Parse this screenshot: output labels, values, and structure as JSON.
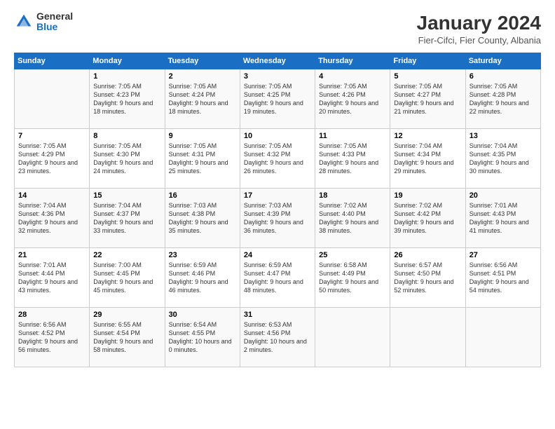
{
  "header": {
    "logo": {
      "general": "General",
      "blue": "Blue"
    },
    "title": "January 2024",
    "subtitle": "Fier-Cifci, Fier County, Albania"
  },
  "calendar": {
    "days": [
      "Sunday",
      "Monday",
      "Tuesday",
      "Wednesday",
      "Thursday",
      "Friday",
      "Saturday"
    ],
    "weeks": [
      [
        {
          "day": "",
          "sunrise": "",
          "sunset": "",
          "daylight": ""
        },
        {
          "day": "1",
          "sunrise": "Sunrise: 7:05 AM",
          "sunset": "Sunset: 4:23 PM",
          "daylight": "Daylight: 9 hours and 18 minutes."
        },
        {
          "day": "2",
          "sunrise": "Sunrise: 7:05 AM",
          "sunset": "Sunset: 4:24 PM",
          "daylight": "Daylight: 9 hours and 18 minutes."
        },
        {
          "day": "3",
          "sunrise": "Sunrise: 7:05 AM",
          "sunset": "Sunset: 4:25 PM",
          "daylight": "Daylight: 9 hours and 19 minutes."
        },
        {
          "day": "4",
          "sunrise": "Sunrise: 7:05 AM",
          "sunset": "Sunset: 4:26 PM",
          "daylight": "Daylight: 9 hours and 20 minutes."
        },
        {
          "day": "5",
          "sunrise": "Sunrise: 7:05 AM",
          "sunset": "Sunset: 4:27 PM",
          "daylight": "Daylight: 9 hours and 21 minutes."
        },
        {
          "day": "6",
          "sunrise": "Sunrise: 7:05 AM",
          "sunset": "Sunset: 4:28 PM",
          "daylight": "Daylight: 9 hours and 22 minutes."
        }
      ],
      [
        {
          "day": "7",
          "sunrise": "Sunrise: 7:05 AM",
          "sunset": "Sunset: 4:29 PM",
          "daylight": "Daylight: 9 hours and 23 minutes."
        },
        {
          "day": "8",
          "sunrise": "Sunrise: 7:05 AM",
          "sunset": "Sunset: 4:30 PM",
          "daylight": "Daylight: 9 hours and 24 minutes."
        },
        {
          "day": "9",
          "sunrise": "Sunrise: 7:05 AM",
          "sunset": "Sunset: 4:31 PM",
          "daylight": "Daylight: 9 hours and 25 minutes."
        },
        {
          "day": "10",
          "sunrise": "Sunrise: 7:05 AM",
          "sunset": "Sunset: 4:32 PM",
          "daylight": "Daylight: 9 hours and 26 minutes."
        },
        {
          "day": "11",
          "sunrise": "Sunrise: 7:05 AM",
          "sunset": "Sunset: 4:33 PM",
          "daylight": "Daylight: 9 hours and 28 minutes."
        },
        {
          "day": "12",
          "sunrise": "Sunrise: 7:04 AM",
          "sunset": "Sunset: 4:34 PM",
          "daylight": "Daylight: 9 hours and 29 minutes."
        },
        {
          "day": "13",
          "sunrise": "Sunrise: 7:04 AM",
          "sunset": "Sunset: 4:35 PM",
          "daylight": "Daylight: 9 hours and 30 minutes."
        }
      ],
      [
        {
          "day": "14",
          "sunrise": "Sunrise: 7:04 AM",
          "sunset": "Sunset: 4:36 PM",
          "daylight": "Daylight: 9 hours and 32 minutes."
        },
        {
          "day": "15",
          "sunrise": "Sunrise: 7:04 AM",
          "sunset": "Sunset: 4:37 PM",
          "daylight": "Daylight: 9 hours and 33 minutes."
        },
        {
          "day": "16",
          "sunrise": "Sunrise: 7:03 AM",
          "sunset": "Sunset: 4:38 PM",
          "daylight": "Daylight: 9 hours and 35 minutes."
        },
        {
          "day": "17",
          "sunrise": "Sunrise: 7:03 AM",
          "sunset": "Sunset: 4:39 PM",
          "daylight": "Daylight: 9 hours and 36 minutes."
        },
        {
          "day": "18",
          "sunrise": "Sunrise: 7:02 AM",
          "sunset": "Sunset: 4:40 PM",
          "daylight": "Daylight: 9 hours and 38 minutes."
        },
        {
          "day": "19",
          "sunrise": "Sunrise: 7:02 AM",
          "sunset": "Sunset: 4:42 PM",
          "daylight": "Daylight: 9 hours and 39 minutes."
        },
        {
          "day": "20",
          "sunrise": "Sunrise: 7:01 AM",
          "sunset": "Sunset: 4:43 PM",
          "daylight": "Daylight: 9 hours and 41 minutes."
        }
      ],
      [
        {
          "day": "21",
          "sunrise": "Sunrise: 7:01 AM",
          "sunset": "Sunset: 4:44 PM",
          "daylight": "Daylight: 9 hours and 43 minutes."
        },
        {
          "day": "22",
          "sunrise": "Sunrise: 7:00 AM",
          "sunset": "Sunset: 4:45 PM",
          "daylight": "Daylight: 9 hours and 45 minutes."
        },
        {
          "day": "23",
          "sunrise": "Sunrise: 6:59 AM",
          "sunset": "Sunset: 4:46 PM",
          "daylight": "Daylight: 9 hours and 46 minutes."
        },
        {
          "day": "24",
          "sunrise": "Sunrise: 6:59 AM",
          "sunset": "Sunset: 4:47 PM",
          "daylight": "Daylight: 9 hours and 48 minutes."
        },
        {
          "day": "25",
          "sunrise": "Sunrise: 6:58 AM",
          "sunset": "Sunset: 4:49 PM",
          "daylight": "Daylight: 9 hours and 50 minutes."
        },
        {
          "day": "26",
          "sunrise": "Sunrise: 6:57 AM",
          "sunset": "Sunset: 4:50 PM",
          "daylight": "Daylight: 9 hours and 52 minutes."
        },
        {
          "day": "27",
          "sunrise": "Sunrise: 6:56 AM",
          "sunset": "Sunset: 4:51 PM",
          "daylight": "Daylight: 9 hours and 54 minutes."
        }
      ],
      [
        {
          "day": "28",
          "sunrise": "Sunrise: 6:56 AM",
          "sunset": "Sunset: 4:52 PM",
          "daylight": "Daylight: 9 hours and 56 minutes."
        },
        {
          "day": "29",
          "sunrise": "Sunrise: 6:55 AM",
          "sunset": "Sunset: 4:54 PM",
          "daylight": "Daylight: 9 hours and 58 minutes."
        },
        {
          "day": "30",
          "sunrise": "Sunrise: 6:54 AM",
          "sunset": "Sunset: 4:55 PM",
          "daylight": "Daylight: 10 hours and 0 minutes."
        },
        {
          "day": "31",
          "sunrise": "Sunrise: 6:53 AM",
          "sunset": "Sunset: 4:56 PM",
          "daylight": "Daylight: 10 hours and 2 minutes."
        },
        {
          "day": "",
          "sunrise": "",
          "sunset": "",
          "daylight": ""
        },
        {
          "day": "",
          "sunrise": "",
          "sunset": "",
          "daylight": ""
        },
        {
          "day": "",
          "sunrise": "",
          "sunset": "",
          "daylight": ""
        }
      ]
    ]
  }
}
